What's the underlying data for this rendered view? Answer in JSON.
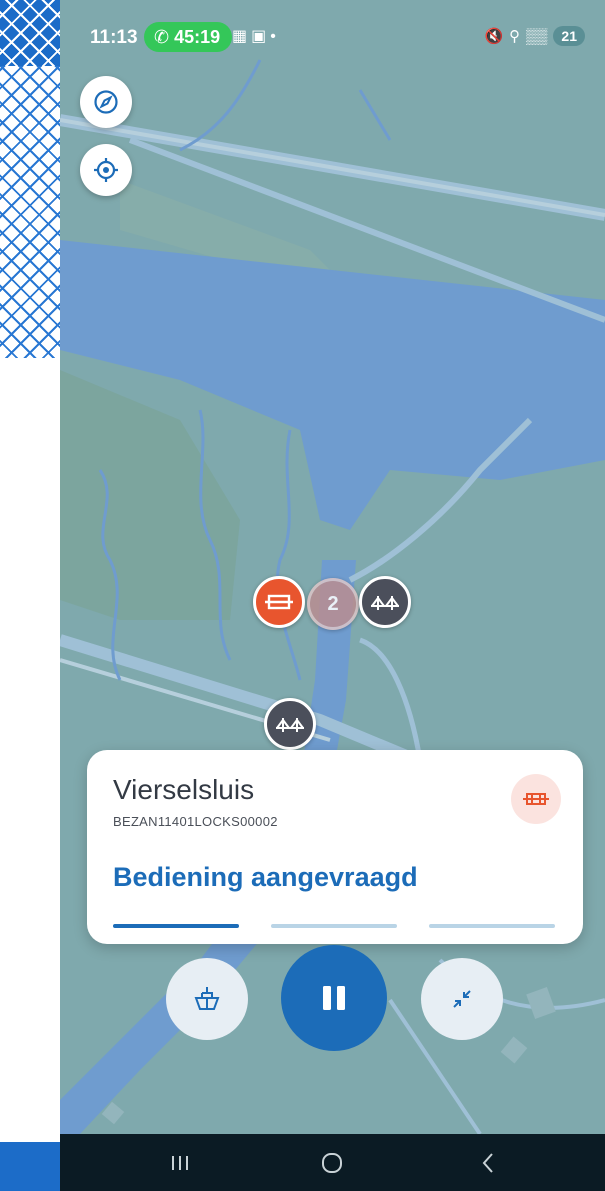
{
  "status_bar": {
    "time": "11:13",
    "call_timer": "45:19",
    "battery": "21",
    "icons": [
      "phone-icon",
      "calendar-icon",
      "screen-record-icon",
      "mute-icon",
      "location-icon",
      "wifi-icon",
      "signal-icon",
      "battery-icon"
    ]
  },
  "map": {
    "compass_icon": "compass-icon",
    "locate_icon": "locate-icon",
    "cluster_count": "2",
    "markers": [
      "lock-marker",
      "cluster-marker",
      "bridge-marker",
      "bridge-marker"
    ]
  },
  "card": {
    "title": "Vierselsluis",
    "code": "BEZAN11401LOCKS00002",
    "status": "Bediening aangevraagd",
    "progress_steps_active": 1,
    "progress_steps_total": 3,
    "type_icon": "lock-icon"
  },
  "controls": {
    "left_icon": "boat-icon",
    "center_icon": "pause-icon",
    "right_icon": "collapse-icon"
  },
  "colors": {
    "accent": "#1c6cb8",
    "lock_marker": "#e8552e",
    "bridge_marker": "#4b4f5b",
    "water": "#6f9ccf",
    "land": "#7fa9ad"
  }
}
